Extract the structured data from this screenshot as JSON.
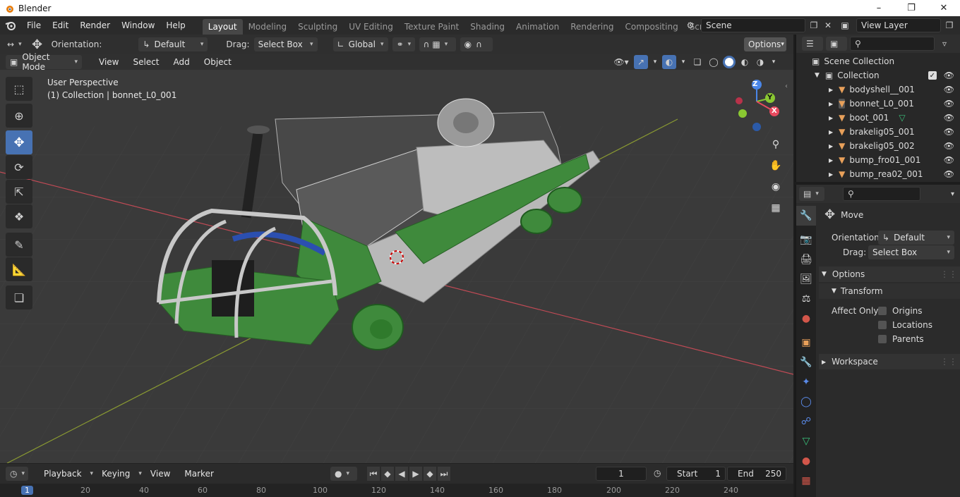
{
  "window": {
    "title": "Blender"
  },
  "menu": [
    "File",
    "Edit",
    "Render",
    "Window",
    "Help"
  ],
  "workspaces": [
    {
      "label": "Layout",
      "active": true
    },
    {
      "label": "Modeling"
    },
    {
      "label": "Sculpting"
    },
    {
      "label": "UV Editing"
    },
    {
      "label": "Texture Paint"
    },
    {
      "label": "Shading"
    },
    {
      "label": "Animation"
    },
    {
      "label": "Rendering"
    },
    {
      "label": "Compositing"
    },
    {
      "label": "Scripting"
    }
  ],
  "scene": {
    "name": "Scene"
  },
  "view_layer": {
    "name": "View Layer"
  },
  "tool_header": {
    "orientation_label": "Orientation:",
    "orientation_value": "Default",
    "drag_label": "Drag:",
    "drag_value": "Select Box",
    "transform_space": "Global",
    "options_label": "Options"
  },
  "viewport_header": {
    "mode": "Object Mode",
    "menus": [
      "View",
      "Select",
      "Add",
      "Object"
    ]
  },
  "viewport": {
    "perspective": "User Perspective",
    "info": "(1) Collection | bonnet_L0_001",
    "axis_colors": {
      "x": "#e84a5f",
      "y": "#8ac832",
      "z": "#4a86e8"
    },
    "axis_labels": {
      "x": "X",
      "y": "Y",
      "z": "Z"
    }
  },
  "timeline": {
    "menus": [
      "Playback",
      "Keying",
      "View",
      "Marker"
    ],
    "current_frame": "1",
    "start_label": "Start",
    "start": "1",
    "end_label": "End",
    "end": "250",
    "ruler": [
      "1",
      "20",
      "40",
      "60",
      "80",
      "100",
      "120",
      "140",
      "160",
      "180",
      "200",
      "220",
      "240"
    ]
  },
  "outliner": {
    "root": "Scene Collection",
    "collection": "Collection",
    "items": [
      "bodyshell__001",
      "bonnet_L0_001",
      "boot_001",
      "brakelig05_001",
      "brakelig05_002",
      "bump_fro01_001",
      "bump_rea02_001"
    ]
  },
  "properties": {
    "tool_name": "Move",
    "orientation_label": "Orientation",
    "orientation_value": "Default",
    "drag_label": "Drag:",
    "drag_value": "Select Box",
    "options_title": "Options",
    "transform_title": "Transform",
    "affect_only_label": "Affect Only",
    "affect_options": [
      "Origins",
      "Locations",
      "Parents"
    ],
    "workspace_title": "Workspace"
  },
  "colors": {
    "accent": "#4772b3",
    "mesh_green": "#3f8a3c",
    "mesh_gray": "#b8b8b8",
    "orange_icon": "#e8a05a"
  }
}
